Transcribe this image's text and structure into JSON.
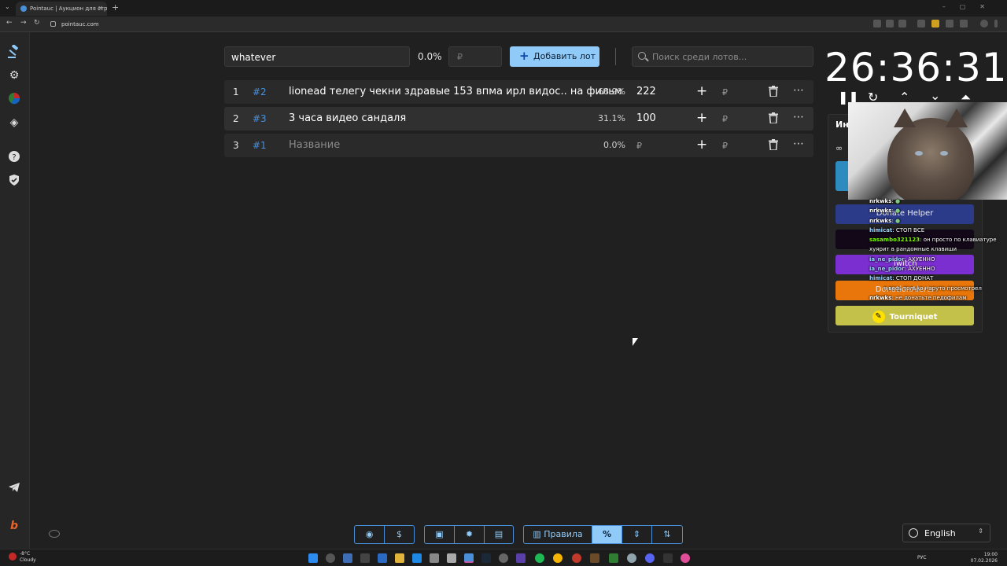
{
  "browser": {
    "tab_title": "Pointauc | Аукцион для стрим...",
    "url": "pointauc.com"
  },
  "sidebar": {
    "items": [
      "auction-icon",
      "settings-icon",
      "stats-pie-icon",
      "layers-icon",
      "help-icon",
      "shield-check-icon"
    ],
    "bottom": [
      "telegram-icon",
      "boosty-icon"
    ]
  },
  "controls": {
    "lot_name_value": "whatever",
    "percent": "0.0%",
    "amount_placeholder": "₽",
    "add_button_label": "Добавить лот",
    "search_placeholder": "Поиск среди лотов..."
  },
  "lots": [
    {
      "index": "1",
      "id": "#2",
      "name": "lionead телегу чекни здравые 153 впма ирл видос.. на фильм",
      "percent": "68.9%",
      "amount": "222"
    },
    {
      "index": "2",
      "id": "#3",
      "name": "3 часа видео сандаля",
      "percent": "31.1%",
      "amount": "100"
    },
    {
      "index": "3",
      "id": "#1",
      "name": "Название",
      "percent": "0.0%",
      "amount": "₽"
    }
  ],
  "currency_symbol": "₽",
  "timer": {
    "value": "26:36:31"
  },
  "right_panel": {
    "title": "Ин",
    "buttons": [
      {
        "label": "",
        "color": "#2e8bc0"
      },
      {
        "label": "Donate Helper",
        "color": "#2c3a8a"
      },
      {
        "label": "",
        "color": "#120818"
      },
      {
        "label": "Twitch",
        "color": "#7b2fd0"
      },
      {
        "label": "DonationAlerts",
        "color": "#e8760a"
      },
      {
        "label": "Tourniquet",
        "color": "#c3c14a"
      }
    ]
  },
  "chat": [
    {
      "user": "nrkwks",
      "text": "",
      "user_color": "#ffffff"
    },
    {
      "user": "nrkwks",
      "text": "",
      "user_color": "#ffffff"
    },
    {
      "user": "nrkwks",
      "text": "",
      "user_color": "#ffffff"
    },
    {
      "user": "himicat",
      "text": "СТОП ВСЕ",
      "user_color": "#9fd6ff"
    },
    {
      "user": "sasambo321123",
      "text": "он просто по клавиатуре",
      "user_color": "#7CFC00"
    },
    {
      "user": "",
      "text": "хуярит в рандомные клавиши",
      "user_color": "#ffffff"
    },
    {
      "user": "ia_ne_pidor",
      "text": "АХУЕННО",
      "user_color": "#9fd6ff"
    },
    {
      "user": "ia_ne_pidor",
      "text": "АХУЕННО",
      "user_color": "#9fd6ff"
    },
    {
      "user": "himicat",
      "text": "СТОП ДОНАТ",
      "user_color": "#9fd6ff"
    },
    {
      "user": "",
      "text": "я весь только наруто просмотрел",
      "user_color": "#ffffff"
    },
    {
      "user": "nrkwks",
      "text": "не донатьте педофилам",
      "user_color": "#ffffff"
    }
  ],
  "bottom_toolbar": {
    "group1": [
      "github-icon",
      "dollar-icon"
    ],
    "group2": [
      "save-icon",
      "bug-icon",
      "delete-all-icon"
    ],
    "group3": {
      "rules_label": "Правила"
    }
  },
  "language": {
    "selected": "English"
  },
  "taskbar": {
    "weather_temp": "-8°C",
    "weather_desc": "Cloudy",
    "lang": "РУС",
    "time": "19:00",
    "date": "07.02.2026"
  }
}
